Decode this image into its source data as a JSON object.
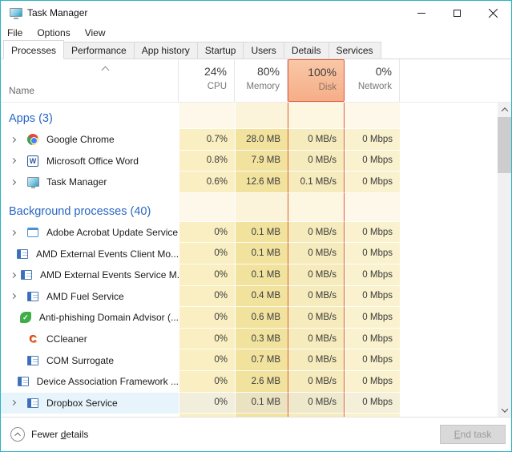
{
  "window": {
    "title": "Task Manager"
  },
  "titlebar": {
    "controls": [
      "minimize-icon",
      "maximize-icon",
      "close-icon"
    ]
  },
  "menu": {
    "items": [
      "File",
      "Options",
      "View"
    ]
  },
  "tabs": {
    "items": [
      {
        "label": "Processes",
        "selected": true
      },
      {
        "label": "Performance",
        "selected": false
      },
      {
        "label": "App history",
        "selected": false
      },
      {
        "label": "Startup",
        "selected": false
      },
      {
        "label": "Users",
        "selected": false
      },
      {
        "label": "Details",
        "selected": false
      },
      {
        "label": "Services",
        "selected": false
      }
    ]
  },
  "columns": {
    "name": {
      "label": "Name",
      "sort_icon": "chevron-up-icon"
    },
    "values": [
      {
        "id": "cpu",
        "pct": "24%",
        "label": "CPU",
        "highlighted": false
      },
      {
        "id": "memory",
        "pct": "80%",
        "label": "Memory",
        "highlighted": false
      },
      {
        "id": "disk",
        "pct": "100%",
        "label": "Disk",
        "highlighted": true
      },
      {
        "id": "network",
        "pct": "0%",
        "label": "Network",
        "highlighted": false
      }
    ]
  },
  "sections": [
    {
      "title": "Apps (3)",
      "rows": [
        {
          "name": "Google Chrome",
          "icon": "chrome-icon",
          "expand": true,
          "selected": false,
          "cpu": "0.7%",
          "memory": "28.0 MB",
          "disk": "0 MB/s",
          "network": "0 Mbps"
        },
        {
          "name": "Microsoft Office Word",
          "icon": "word-icon",
          "expand": true,
          "selected": false,
          "cpu": "0.8%",
          "memory": "7.9 MB",
          "disk": "0 MB/s",
          "network": "0 Mbps"
        },
        {
          "name": "Task Manager",
          "icon": "task-manager-icon",
          "expand": true,
          "selected": false,
          "cpu": "0.6%",
          "memory": "12.6 MB",
          "disk": "0.1 MB/s",
          "network": "0 Mbps"
        }
      ]
    },
    {
      "title": "Background processes (40)",
      "rows": [
        {
          "name": "Adobe Acrobat Update Service",
          "icon": "adobe-updater-icon",
          "expand": true,
          "selected": false,
          "cpu": "0%",
          "memory": "0.1 MB",
          "disk": "0 MB/s",
          "network": "0 Mbps"
        },
        {
          "name": "AMD External Events Client Mo...",
          "icon": "service-window-icon",
          "expand": false,
          "selected": false,
          "cpu": "0%",
          "memory": "0.1 MB",
          "disk": "0 MB/s",
          "network": "0 Mbps"
        },
        {
          "name": "AMD External Events Service M...",
          "icon": "service-window-icon",
          "expand": true,
          "selected": false,
          "cpu": "0%",
          "memory": "0.1 MB",
          "disk": "0 MB/s",
          "network": "0 Mbps"
        },
        {
          "name": "AMD Fuel Service",
          "icon": "service-window-icon",
          "expand": true,
          "selected": false,
          "cpu": "0%",
          "memory": "0.4 MB",
          "disk": "0 MB/s",
          "network": "0 Mbps"
        },
        {
          "name": "Anti-phishing Domain Advisor (...",
          "icon": "anti-phishing-icon",
          "expand": false,
          "selected": false,
          "cpu": "0%",
          "memory": "0.6 MB",
          "disk": "0 MB/s",
          "network": "0 Mbps"
        },
        {
          "name": "CCleaner",
          "icon": "ccleaner-icon",
          "expand": false,
          "selected": false,
          "cpu": "0%",
          "memory": "0.3 MB",
          "disk": "0 MB/s",
          "network": "0 Mbps"
        },
        {
          "name": "COM Surrogate",
          "icon": "service-window-icon",
          "expand": false,
          "selected": false,
          "cpu": "0%",
          "memory": "0.7 MB",
          "disk": "0 MB/s",
          "network": "0 Mbps"
        },
        {
          "name": "Device Association Framework ...",
          "icon": "service-window-icon",
          "expand": false,
          "selected": false,
          "cpu": "0%",
          "memory": "2.6 MB",
          "disk": "0 MB/s",
          "network": "0 Mbps"
        },
        {
          "name": "Dropbox Service",
          "icon": "service-window-icon",
          "expand": true,
          "selected": true,
          "cpu": "0%",
          "memory": "0.1 MB",
          "disk": "0 MB/s",
          "network": "0 Mbps"
        }
      ]
    }
  ],
  "footer": {
    "fewer_details": {
      "pre": "Fewer ",
      "key": "d",
      "rest": "etails",
      "icon": "chevron-up-circle-icon"
    },
    "end_task": {
      "key": "E",
      "rest": "nd task",
      "enabled": false
    }
  },
  "colors": {
    "accent_border": "#2bb4c6",
    "disk_highlight_border": "#e0563a",
    "disk_header_bg": "#f7ba97",
    "heat_cpu": "#f9efc2",
    "heat_memory": "#f1e29e",
    "heat_disk": "#f6ebbc",
    "heat_network": "#faf2cf",
    "selection_row": "#e7f4fc",
    "section_title_text": "#2866c5"
  }
}
